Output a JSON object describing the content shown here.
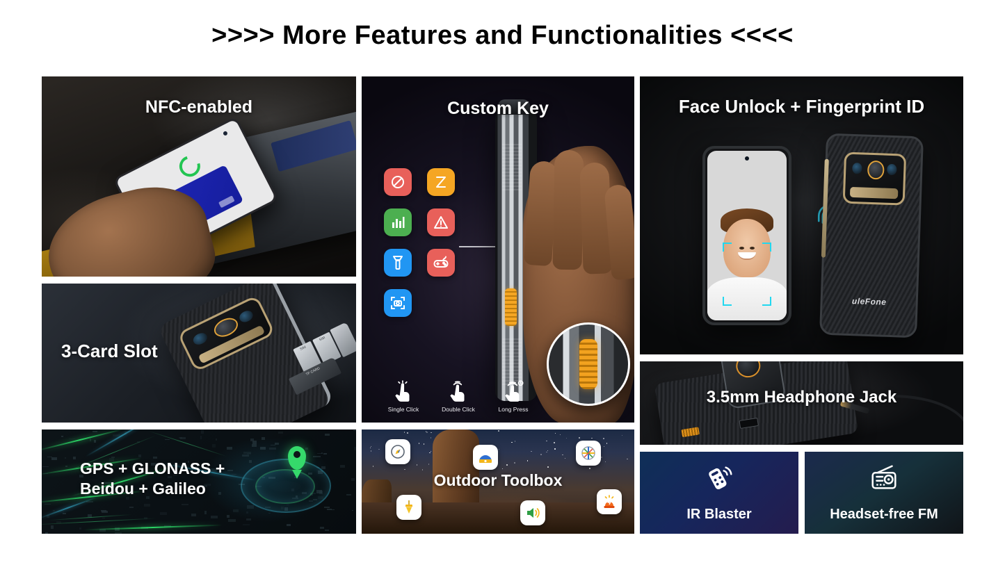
{
  "header": {
    "title": ">>>> More Features and Functionalities <<<<"
  },
  "panels": {
    "nfc": {
      "caption": "NFC-enabled"
    },
    "card_slot": {
      "caption": "3-Card Slot",
      "tray_labels": [
        "SIM",
        "SIM",
        "TF CARD"
      ]
    },
    "gps": {
      "caption": "GPS + GLONASS +\nBeidou + Galileo"
    },
    "custom_key": {
      "caption": "Custom Key",
      "shortcut_icons": [
        {
          "name": "do-not-disturb-icon",
          "color": "#e8605a"
        },
        {
          "name": "zello-walkie-talkie-icon",
          "color": "#f5a623"
        },
        {
          "name": "sound-meter-icon",
          "color": "#4caf50"
        },
        {
          "name": "sos-warning-icon",
          "color": "#e8605a"
        },
        {
          "name": "flashlight-icon",
          "color": "#2196f3"
        },
        {
          "name": "game-controller-icon",
          "color": "#e8605a"
        },
        {
          "name": "camera-scan-icon",
          "color": "#2196f3"
        }
      ],
      "gestures": [
        {
          "label": "Single Click",
          "icon": "single-tap-icon"
        },
        {
          "label": "Double Click",
          "icon": "double-tap-icon"
        },
        {
          "label": "Long Press",
          "icon": "long-press-icon"
        }
      ]
    },
    "outdoor_toolbox": {
      "caption": "Outdoor Toolbox",
      "tool_icons": [
        {
          "name": "compass-icon"
        },
        {
          "name": "protractor-level-icon"
        },
        {
          "name": "crosshair-alignment-icon"
        },
        {
          "name": "plumb-bob-icon"
        },
        {
          "name": "sound-meter-speaker-icon"
        },
        {
          "name": "alarm-beacon-icon"
        }
      ]
    },
    "face_unlock": {
      "caption": "Face Unlock + Fingerprint ID",
      "brand": "uleFone"
    },
    "headphone_jack": {
      "caption": "3.5mm Headphone Jack"
    },
    "ir_blaster": {
      "caption": "IR Blaster",
      "icon": "remote-control-icon"
    },
    "fm_radio": {
      "caption": "Headset-free FM",
      "icon": "radio-icon"
    }
  },
  "colors": {
    "accent_orange": "#f5a623",
    "accent_green": "#35d96b",
    "accent_cyan": "#21d8f0",
    "background": "#ffffff"
  }
}
